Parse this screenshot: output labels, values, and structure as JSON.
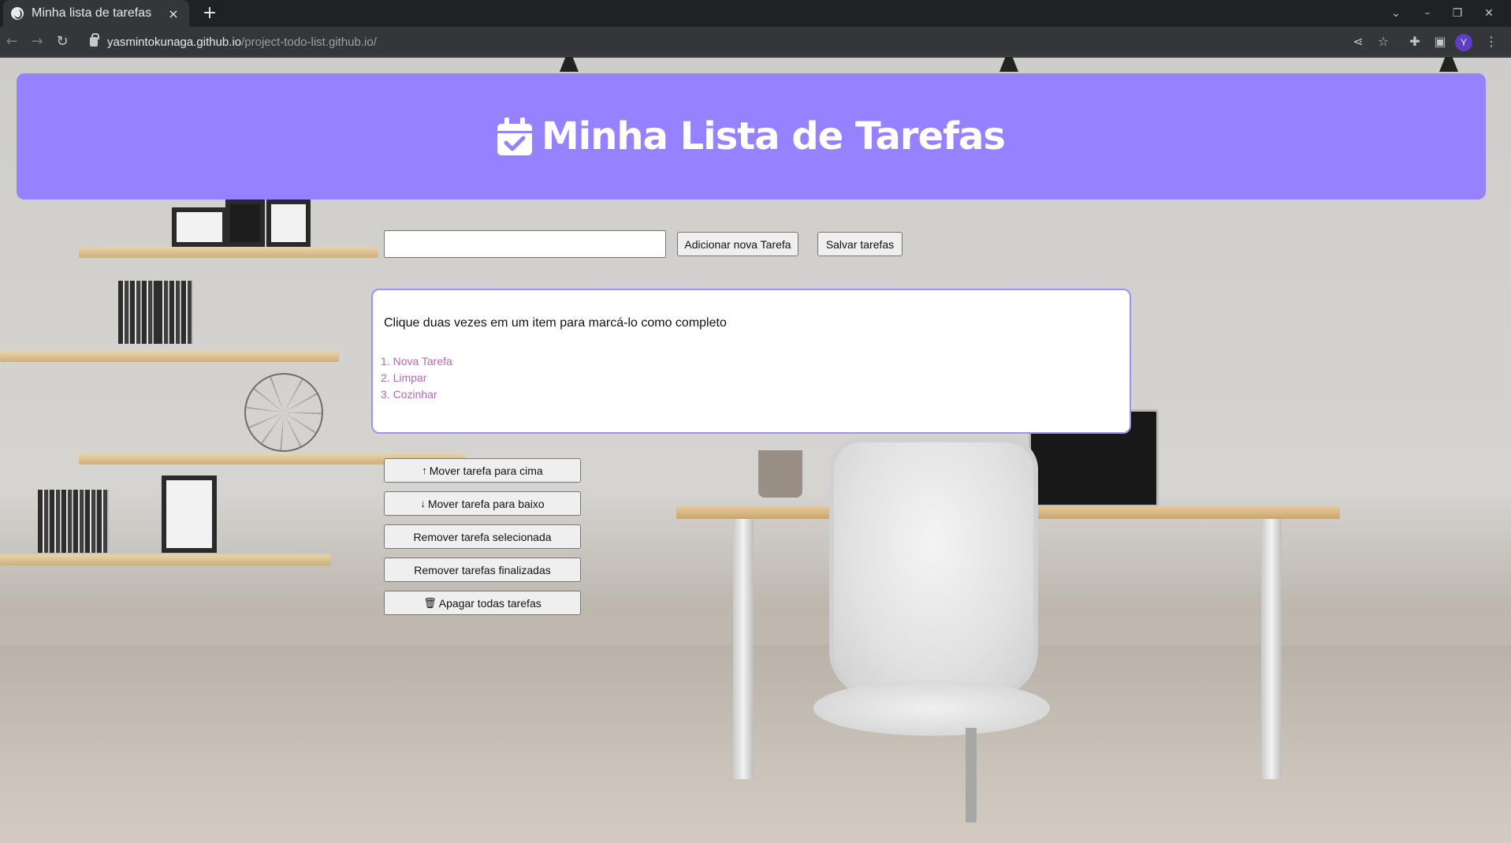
{
  "browser": {
    "tab_title": "Minha lista de tarefas",
    "tab_close": "×",
    "new_tab": "+",
    "url_host": "yasmintokunaga.github.io",
    "url_path": "/project-todo-list.github.io/",
    "profile_initial": "Y",
    "icons": [
      "globe-icon",
      "close-icon",
      "plus-icon",
      "chevron-down-icon",
      "minimize-icon",
      "restore-icon",
      "close-window-icon",
      "back-icon",
      "forward-icon",
      "reload-icon",
      "lock-icon",
      "share-icon",
      "star-icon",
      "extensions-icon",
      "side-panel-icon",
      "menu-icon"
    ]
  },
  "header": {
    "title": "Minha Lista de Tarefas",
    "icon": "calendar-check-icon",
    "color": "#9682ff"
  },
  "form": {
    "input_value": "",
    "add_label": "Adicionar nova Tarefa",
    "save_label": "Salvar tarefas"
  },
  "list": {
    "instructions": "Clique duas vezes em um item para marcá-lo como completo",
    "items": [
      "Nova Tarefa",
      "Limpar",
      "Cozinhar"
    ],
    "item_color": "#b666b6"
  },
  "actions": {
    "move_up": "Mover tarefa para cima",
    "move_down": "Mover tarefa para baixo",
    "remove_selected": "Remover tarefa selecionada",
    "remove_finished": "Remover tarefas finalizadas",
    "clear_all": "Apagar todas tarefas"
  }
}
